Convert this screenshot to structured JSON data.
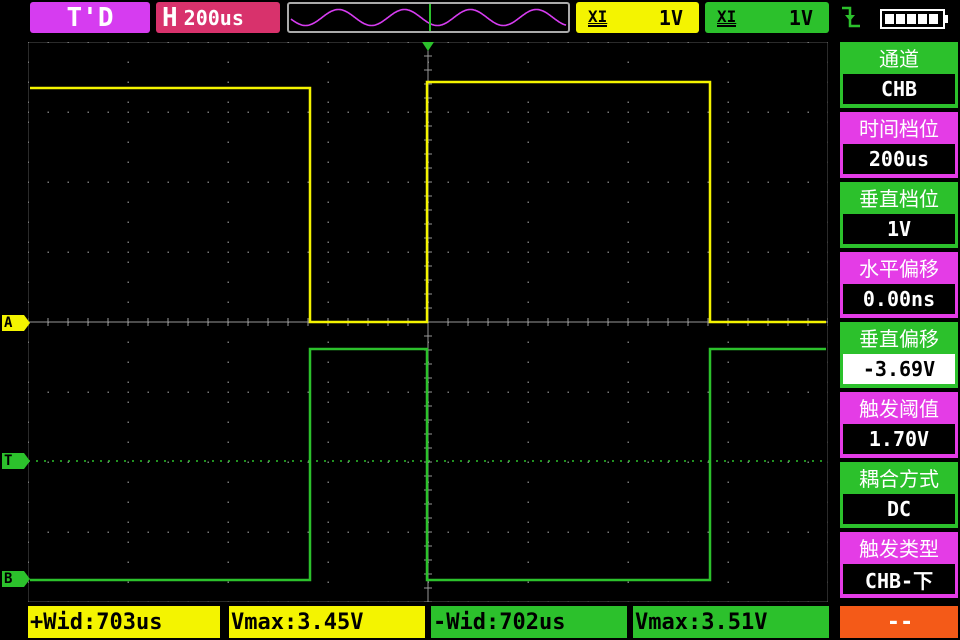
{
  "top": {
    "status": "T'D",
    "timebase_prefix": "H",
    "timebase": "200us",
    "chA": {
      "coupling": "XI",
      "scale": "1V"
    },
    "chB": {
      "coupling": "XI",
      "scale": "1V"
    }
  },
  "markers": {
    "a": "A",
    "t": "T",
    "b": "B"
  },
  "menu": [
    {
      "title": "通道",
      "value": "CHB"
    },
    {
      "title": "时间档位",
      "value": "200us"
    },
    {
      "title": "垂直档位",
      "value": "1V"
    },
    {
      "title": "水平偏移",
      "value": "0.00ns"
    },
    {
      "title": "垂直偏移",
      "value": "-3.69V"
    },
    {
      "title": "触发阈值",
      "value": "1.70V"
    },
    {
      "title": "耦合方式",
      "value": "DC"
    },
    {
      "title": "触发类型",
      "value": "CHB-下"
    }
  ],
  "measurements": {
    "m1": "+Wid:703us",
    "m2": "Vmax:3.45V",
    "m3": "-Wid:702us",
    "m4": "Vmax:3.51V",
    "m5": "--"
  },
  "colors": {
    "channel_a": "#f4f400",
    "channel_b": "#2cc12c",
    "menu_green": "#2cc12c",
    "menu_magenta": "#e43ce6",
    "status_magenta": "#d63cf0",
    "timebase_red": "#d8326c",
    "alert_orange": "#f45a18"
  }
}
